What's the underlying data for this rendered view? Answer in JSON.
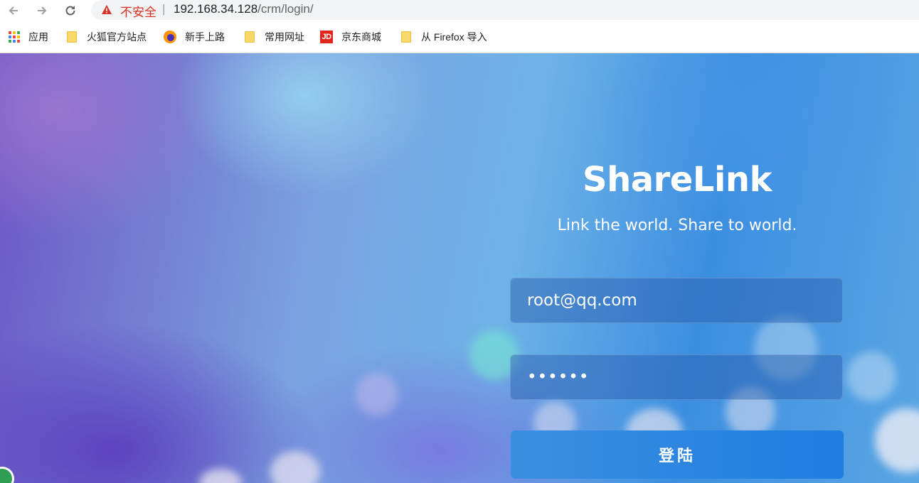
{
  "browser": {
    "security_label": "不安全",
    "separator": "|",
    "url_host": "192.168.34.128",
    "url_path": "/crm/login/"
  },
  "bookmarks": [
    {
      "label": "应用",
      "icon": "apps-grid-icon"
    },
    {
      "label": "火狐官方站点",
      "icon": "folder-icon"
    },
    {
      "label": "新手上路",
      "icon": "firefox-icon"
    },
    {
      "label": "常用网址",
      "icon": "folder-icon"
    },
    {
      "label": "京东商城",
      "icon": "jd-icon"
    },
    {
      "label": "从 Firefox 导入",
      "icon": "folder-icon"
    }
  ],
  "jd_icon_text": "JD",
  "login": {
    "title": "ShareLink",
    "tagline": "Link the world. Share to world.",
    "email_value": "root@qq.com",
    "password_value": "••••••",
    "submit_label": "登陆"
  },
  "colors": {
    "warning": "#d93025",
    "button": "#1f7de0"
  }
}
